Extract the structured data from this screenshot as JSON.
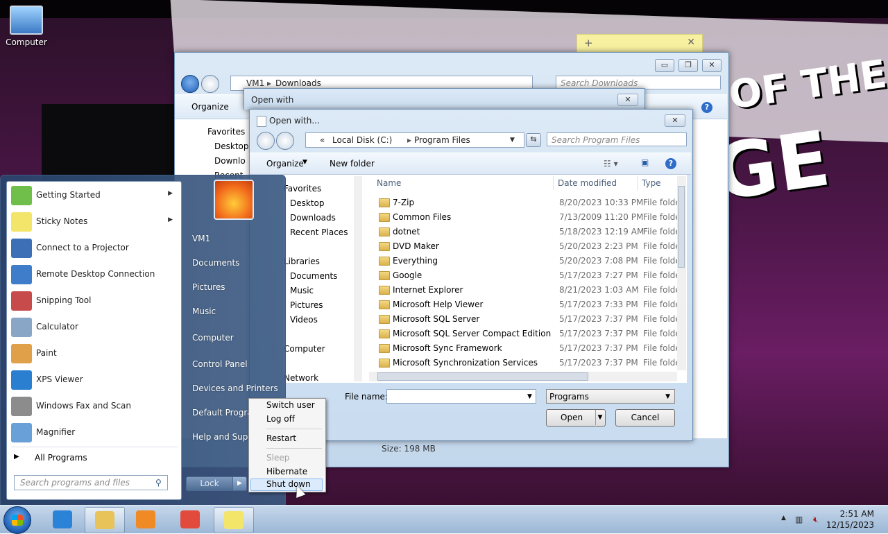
{
  "desktop": {
    "icons": [
      {
        "label": "Computer"
      }
    ],
    "wallpaper_text": [
      "OF THE",
      "GE"
    ]
  },
  "explorer": {
    "breadcrumb": [
      "VM1",
      "Downloads"
    ],
    "search_placeholder": "Search Downloads",
    "organize": "Organize",
    "nav": [
      "Favorites",
      "Desktop",
      "Downlo",
      "Recent"
    ],
    "status": "Size: 198 MB"
  },
  "open_with_outer": {
    "title": "Open with"
  },
  "dialog": {
    "title": "Open with...",
    "breadcrumb": [
      "«",
      "Local Disk (C:)",
      "Program Files"
    ],
    "search_placeholder": "Search Program Files",
    "organize": "Organize",
    "new_folder": "New folder",
    "nav": [
      {
        "label": "Favorites",
        "indent": 0
      },
      {
        "label": "Desktop",
        "indent": 1
      },
      {
        "label": "Downloads",
        "indent": 1
      },
      {
        "label": "Recent Places",
        "indent": 1
      },
      {
        "label": "Libraries",
        "indent": 0
      },
      {
        "label": "Documents",
        "indent": 1
      },
      {
        "label": "Music",
        "indent": 1
      },
      {
        "label": "Pictures",
        "indent": 1
      },
      {
        "label": "Videos",
        "indent": 1
      },
      {
        "label": "Computer",
        "indent": 0
      },
      {
        "label": "Network",
        "indent": 0
      }
    ],
    "columns": [
      "Name",
      "Date modified",
      "Type"
    ],
    "files": [
      {
        "name": "7-Zip",
        "date": "8/20/2023 10:33 PM",
        "type": "File folde"
      },
      {
        "name": "Common Files",
        "date": "7/13/2009 11:20 PM",
        "type": "File folde"
      },
      {
        "name": "dotnet",
        "date": "5/18/2023 12:19 AM",
        "type": "File folde"
      },
      {
        "name": "DVD Maker",
        "date": "5/20/2023 2:23 PM",
        "type": "File folde"
      },
      {
        "name": "Everything",
        "date": "5/20/2023 7:08 PM",
        "type": "File folde"
      },
      {
        "name": "Google",
        "date": "5/17/2023 7:27 PM",
        "type": "File folde"
      },
      {
        "name": "Internet Explorer",
        "date": "8/21/2023 1:03 AM",
        "type": "File folde"
      },
      {
        "name": "Microsoft Help Viewer",
        "date": "5/17/2023 7:33 PM",
        "type": "File folde"
      },
      {
        "name": "Microsoft SQL Server",
        "date": "5/17/2023 7:37 PM",
        "type": "File folde"
      },
      {
        "name": "Microsoft SQL Server Compact Edition",
        "date": "5/17/2023 7:37 PM",
        "type": "File folde"
      },
      {
        "name": "Microsoft Sync Framework",
        "date": "5/17/2023 7:37 PM",
        "type": "File folde"
      },
      {
        "name": "Microsoft Synchronization Services",
        "date": "5/17/2023 7:37 PM",
        "type": "File folde"
      }
    ],
    "file_name_label": "File name:",
    "file_name_value": "",
    "filter": "Programs",
    "open_label": "Open",
    "cancel_label": "Cancel"
  },
  "start_menu": {
    "programs": [
      {
        "label": "Getting Started",
        "icon": "getting-started-icon",
        "color": "#6fbf4a",
        "submenu": true
      },
      {
        "label": "Sticky Notes",
        "icon": "sticky-notes-icon",
        "color": "#f3e46a",
        "submenu": true
      },
      {
        "label": "Connect to a Projector",
        "icon": "projector-icon",
        "color": "#3c6fb6",
        "submenu": false
      },
      {
        "label": "Remote Desktop Connection",
        "icon": "remote-desktop-icon",
        "color": "#3f7cc9",
        "submenu": false
      },
      {
        "label": "Snipping Tool",
        "icon": "scissors-icon",
        "color": "#c84b4b",
        "submenu": false
      },
      {
        "label": "Calculator",
        "icon": "calculator-icon",
        "color": "#8aa6c6",
        "submenu": false
      },
      {
        "label": "Paint",
        "icon": "paint-icon",
        "color": "#e0a04a",
        "submenu": false
      },
      {
        "label": "XPS Viewer",
        "icon": "xps-viewer-icon",
        "color": "#2a7fd0",
        "submenu": false
      },
      {
        "label": "Windows Fax and Scan",
        "icon": "fax-scan-icon",
        "color": "#8c8c8c",
        "submenu": false
      },
      {
        "label": "Magnifier",
        "icon": "magnifier-icon",
        "color": "#6aa0d8",
        "submenu": false
      }
    ],
    "all_programs": "All Programs",
    "search_placeholder": "Search programs and files",
    "right_items": [
      "VM1",
      "Documents",
      "Pictures",
      "Music",
      "Computer",
      "Control Panel",
      "Devices and Printers",
      "Default Programs",
      "Help and Support"
    ],
    "lock_label": "Lock"
  },
  "power_menu": {
    "items": [
      {
        "label": "Switch user",
        "disabled": false
      },
      {
        "label": "Log off",
        "disabled": false
      },
      {
        "label": "Restart",
        "disabled": false
      },
      {
        "label": "Sleep",
        "disabled": true
      },
      {
        "label": "Hibernate",
        "disabled": false
      },
      {
        "label": "Shut down",
        "disabled": false
      }
    ],
    "highlighted": "Shut down"
  },
  "taskbar": {
    "pinned": [
      {
        "name": "ie-icon",
        "color": "#2b83d8",
        "open": false
      },
      {
        "name": "explorer-icon",
        "color": "#e8c35a",
        "open": true
      },
      {
        "name": "media-player-icon",
        "color": "#f08a24",
        "open": false
      },
      {
        "name": "chrome-icon",
        "color": "#e24a3b",
        "open": false
      },
      {
        "name": "sticky-notes-task-icon",
        "color": "#f3e46a",
        "open": true
      }
    ],
    "time": "2:51 AM",
    "date": "12/15/2023"
  }
}
